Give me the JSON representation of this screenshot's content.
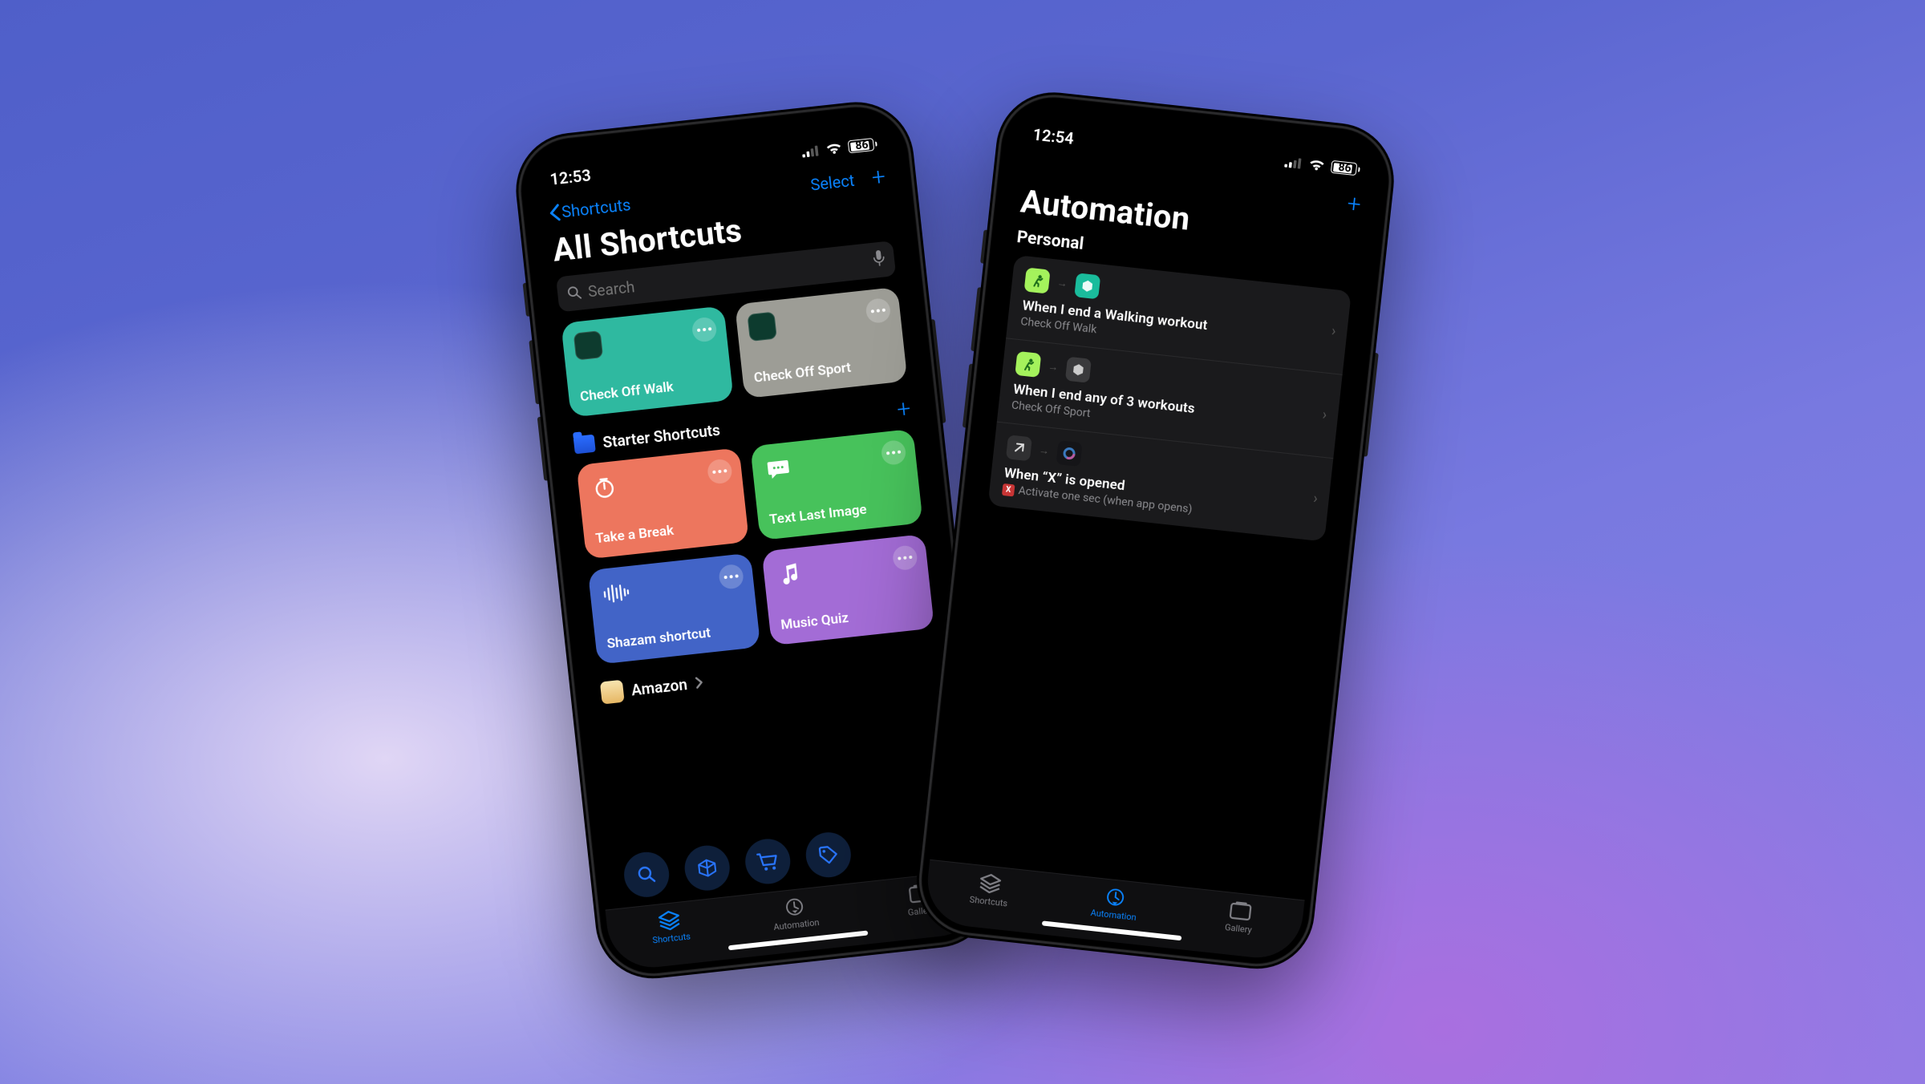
{
  "left": {
    "status": {
      "time": "12:53",
      "battery": "86"
    },
    "nav": {
      "back": "Shortcuts",
      "select": "Select"
    },
    "title": "All Shortcuts",
    "search_placeholder": "Search",
    "tiles_top": [
      {
        "label": "Check Off Walk",
        "color": "#2fb9a0"
      },
      {
        "label": "Check Off Sport",
        "color": "#9d9d96"
      }
    ],
    "starter_header": "Starter Shortcuts",
    "tiles_starter": [
      {
        "label": "Take a Break",
        "color": "#ed765e",
        "icon": "timer"
      },
      {
        "label": "Text Last Image",
        "color": "#47c25b",
        "icon": "chat"
      },
      {
        "label": "Shazam shortcut",
        "color": "#4264c7",
        "icon": "wave"
      },
      {
        "label": "Music Quiz",
        "color": "#a36cd6",
        "icon": "note"
      }
    ],
    "amazon": "Amazon",
    "tabs": {
      "shortcuts": "Shortcuts",
      "automation": "Automation",
      "gallery": "Gallery"
    }
  },
  "right": {
    "status": {
      "time": "12:54",
      "battery": "86"
    },
    "title": "Automation",
    "section": "Personal",
    "items": [
      {
        "title": "When I end a Walking workout",
        "sub": "Check Off Walk",
        "icons": "green-teal"
      },
      {
        "title": "When I end any of 3 workouts",
        "sub": "Check Off Sport",
        "icons": "green-gray"
      },
      {
        "title": "When “X” is opened",
        "sub": "Activate one sec (when app opens)",
        "icons": "open-app",
        "redx": true
      }
    ],
    "tabs": {
      "shortcuts": "Shortcuts",
      "automation": "Automation",
      "gallery": "Gallery"
    }
  }
}
